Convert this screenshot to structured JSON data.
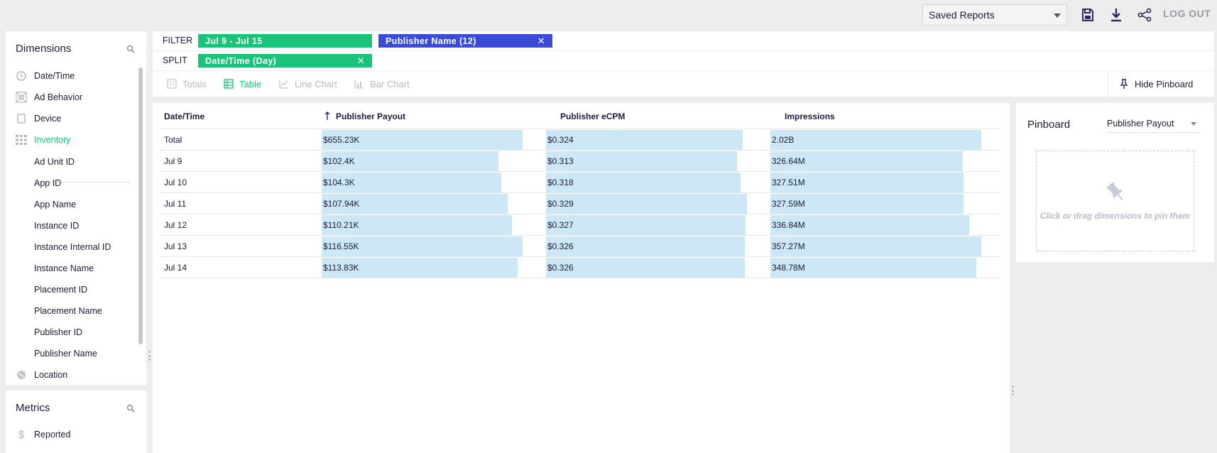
{
  "header": {
    "saved_reports_label": "Saved Reports",
    "logout_label": "LOG OUT"
  },
  "dimensions": {
    "title": "Dimensions",
    "items": [
      {
        "label": "Date/Time",
        "icon": "clock-icon"
      },
      {
        "label": "Ad Behavior",
        "icon": "ad-behavior-icon"
      },
      {
        "label": "Device",
        "icon": "device-icon"
      },
      {
        "label": "Inventory",
        "icon": "grid-icon",
        "active": true
      },
      {
        "label": "Ad Unit ID"
      },
      {
        "label": "App ID"
      },
      {
        "label": "App Name"
      },
      {
        "label": "Instance ID"
      },
      {
        "label": "Instance Internal ID"
      },
      {
        "label": "Instance Name"
      },
      {
        "label": "Placement ID"
      },
      {
        "label": "Placement Name"
      },
      {
        "label": "Publisher ID"
      },
      {
        "label": "Publisher Name"
      },
      {
        "label": "Location",
        "icon": "globe-icon"
      }
    ]
  },
  "metrics": {
    "title": "Metrics",
    "items": [
      {
        "label": "Reported",
        "icon": "dollar-icon"
      }
    ]
  },
  "filter": {
    "label": "FILTER",
    "pills": [
      {
        "label": "Jul 9 - Jul 15",
        "color": "#19c47a"
      },
      {
        "label": "Publisher Name (12)",
        "color": "#3b4bd8"
      }
    ]
  },
  "split": {
    "label": "SPLIT",
    "pills": [
      {
        "label": "Date/Time (Day)",
        "color": "#19c47a"
      }
    ]
  },
  "viz_tabs": [
    {
      "label": "Totals",
      "icon": "totals-icon"
    },
    {
      "label": "Table",
      "icon": "table-icon",
      "active": true
    },
    {
      "label": "Line Chart",
      "icon": "line-chart-icon"
    },
    {
      "label": "Bar Chart",
      "icon": "bar-chart-icon"
    }
  ],
  "hide_pinboard_label": "Hide Pinboard",
  "table": {
    "columns": [
      "Date/Time",
      "Publisher Payout",
      "Publisher eCPM",
      "Impressions"
    ],
    "rows": [
      {
        "label": "Total",
        "payout": "$655.23K",
        "ecpm": "$0.324",
        "impressions": "2.02B",
        "payout_fill": 1.0,
        "ecpm_fill": 0.98,
        "impressions_fill": 1.0
      },
      {
        "label": "Jul 9",
        "payout": "$102.4K",
        "ecpm": "$0.313",
        "impressions": "326.64M",
        "payout_fill": 0.879,
        "ecpm_fill": 0.951,
        "impressions_fill": 0.914
      },
      {
        "label": "Jul 10",
        "payout": "$104.3K",
        "ecpm": "$0.318",
        "impressions": "327.51M",
        "payout_fill": 0.895,
        "ecpm_fill": 0.967,
        "impressions_fill": 0.917
      },
      {
        "label": "Jul 11",
        "payout": "$107.94K",
        "ecpm": "$0.329",
        "impressions": "327.59M",
        "payout_fill": 0.926,
        "ecpm_fill": 1.0,
        "impressions_fill": 0.917
      },
      {
        "label": "Jul 12",
        "payout": "$110.21K",
        "ecpm": "$0.327",
        "impressions": "336.84M",
        "payout_fill": 0.946,
        "ecpm_fill": 0.994,
        "impressions_fill": 0.943
      },
      {
        "label": "Jul 13",
        "payout": "$116.55K",
        "ecpm": "$0.326",
        "impressions": "357.27M",
        "payout_fill": 1.0,
        "ecpm_fill": 0.991,
        "impressions_fill": 1.0
      },
      {
        "label": "Jul 14",
        "payout": "$113.83K",
        "ecpm": "$0.326",
        "impressions": "348.78M",
        "payout_fill": 0.977,
        "ecpm_fill": 0.991,
        "impressions_fill": 0.976
      }
    ]
  },
  "pinboard": {
    "title": "Pinboard",
    "selected": "Publisher Payout",
    "hint": "Click or drag dimensions to pin them"
  },
  "colors": {
    "accent_green": "#19c47a",
    "accent_blue": "#3b4bd8",
    "bar_fill": "#cce8f7",
    "text_dark": "#1b1a3a"
  }
}
